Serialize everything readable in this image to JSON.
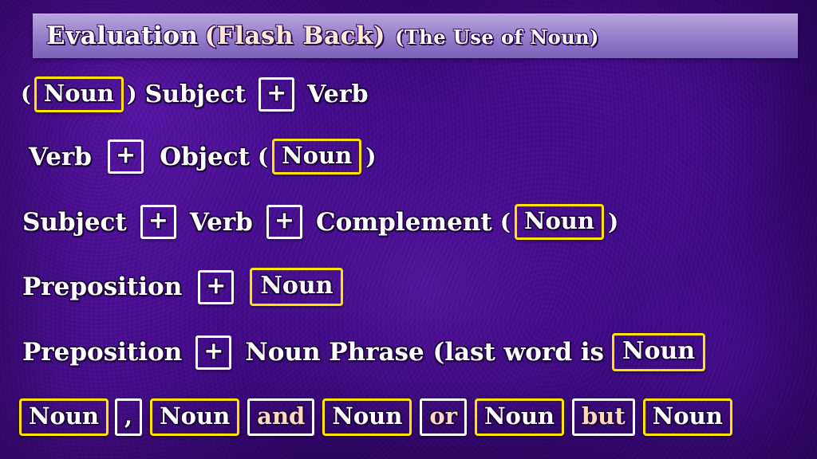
{
  "title": {
    "main": "Evaluation",
    "highlight": "(Flash Back)",
    "subtitle": "(The Use of Noun)"
  },
  "colors": {
    "background": "#3b0a78",
    "title_bar": "#9d87cf",
    "noun_box_border": "#ffe400",
    "plain_box_border": "#ffffff",
    "text": "#ffffff",
    "highlight_text": "#ffe9d6"
  },
  "lines": {
    "line1": {
      "open_paren": "(",
      "noun": "Noun",
      "close_paren": ")",
      "subject": "Subject",
      "plus": "+",
      "verb": "Verb"
    },
    "line2": {
      "verb": "Verb",
      "plus": "+",
      "object": "Object",
      "open_paren": "(",
      "noun": "Noun",
      "close_paren": ")"
    },
    "line3": {
      "subject": "Subject",
      "plus1": "+",
      "verb": "Verb",
      "plus2": "+",
      "complement": "Complement",
      "open_paren": "(",
      "noun": "Noun",
      "close_paren": ")"
    },
    "line4": {
      "preposition": "Preposition",
      "plus": "+",
      "noun": "Noun"
    },
    "line5": {
      "preposition": "Preposition",
      "plus": "+",
      "noun_phrase": "Noun Phrase (last word is",
      "noun": "Noun"
    },
    "line6": {
      "noun1": "Noun",
      "comma": ",",
      "noun2": "Noun",
      "and": "and",
      "noun3": "Noun",
      "or": "or",
      "noun4": "Noun",
      "but": "but",
      "noun5": "Noun"
    }
  }
}
